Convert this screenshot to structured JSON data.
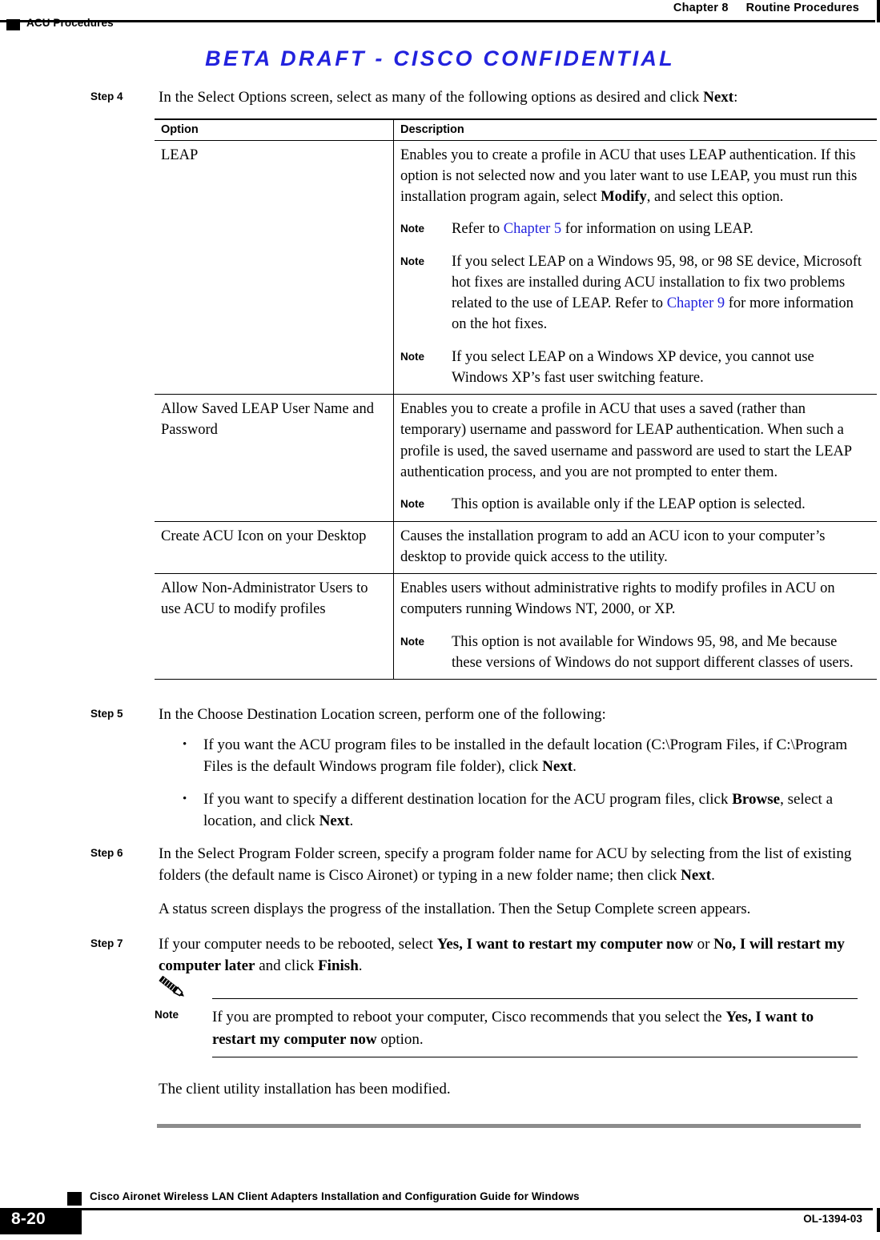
{
  "header": {
    "chapter_number": "Chapter 8",
    "chapter_title": "Routine Procedures",
    "section_label": "ACU Procedures"
  },
  "draft_banner": "BETA DRAFT - CISCO CONFIDENTIAL",
  "steps": {
    "step4": {
      "label": "Step 4",
      "text_a": "In the Select Options screen, select as many of the following options as desired and click ",
      "bold_a": "Next",
      "text_b": ":"
    },
    "step5": {
      "label": "Step 5",
      "text": "In the Choose Destination Location screen, perform one of the following:",
      "bullets": [
        {
          "marker": "•",
          "part1": "If you want the ACU program files to be installed in the default location (C:\\Program Files, if C:\\Program Files is the default Windows program file folder), click ",
          "bold1": "Next",
          "part2": "."
        },
        {
          "marker": "•",
          "part1": "If you want to specify a different destination location for the ACU program files, click ",
          "bold1": "Browse",
          "part2": ", select a location, and click ",
          "bold2": "Next",
          "part3": "."
        }
      ]
    },
    "step6": {
      "label": "Step 6",
      "part1": "In the Select Program Folder screen, specify a program folder name for ACU by selecting from the list of existing folders (the default name is Cisco Aironet) or typing in a new folder name; then click ",
      "bold1": "Next",
      "part2": ".",
      "followup": "A status screen displays the progress of the installation. Then the Setup Complete screen appears."
    },
    "step7": {
      "label": "Step 7",
      "part1": "If your computer needs to be rebooted, select ",
      "bold1": "Yes, I want to restart my computer now",
      "part2": " or ",
      "bold2": "No, I will restart my computer later",
      "part3": " and click ",
      "bold3": "Finish",
      "part4": "."
    }
  },
  "table": {
    "headers": {
      "option": "Option",
      "description": "Description"
    },
    "rows": [
      {
        "option": "LEAP",
        "desc_part1": "Enables you to create a profile in ACU that uses LEAP authentication. If this option is not selected now and you later want to use LEAP, you must run this installation program again, select ",
        "desc_bold1": "Modify",
        "desc_part2": ", and select this option.",
        "notes": [
          {
            "label": "Note",
            "part1": "Refer to ",
            "link1": "Chapter 5",
            "part2": " for information on using LEAP."
          },
          {
            "label": "Note",
            "part1": "If you select LEAP on a Windows 95, 98, or 98 SE device, Microsoft hot fixes are installed during ACU installation to fix two problems related to the use of LEAP. Refer to ",
            "link1": "Chapter 9",
            "part2": " for more information on the hot fixes."
          },
          {
            "label": "Note",
            "part1": "If you select LEAP on a Windows XP device, you cannot use Windows XP’s fast user switching feature.",
            "link1": "",
            "part2": ""
          }
        ]
      },
      {
        "option": "Allow Saved LEAP User Name and Password",
        "desc_part1": "Enables you to create a profile in ACU that uses a saved (rather than temporary) username and password for LEAP authentication. When such a profile is used, the saved username and password are used to start the LEAP authentication process, and you are not prompted to enter them.",
        "desc_bold1": "",
        "desc_part2": "",
        "notes": [
          {
            "label": "Note",
            "part1": "This option is available only if the LEAP option is selected.",
            "link1": "",
            "part2": ""
          }
        ]
      },
      {
        "option": "Create ACU Icon on your Desktop",
        "desc_part1": "Causes the installation program to add an ACU icon to your computer’s desktop to provide quick access to the utility.",
        "desc_bold1": "",
        "desc_part2": "",
        "notes": []
      },
      {
        "option": "Allow Non-Administrator Users to use ACU to modify profiles",
        "desc_part1": "Enables users without administrative rights to modify profiles in ACU on computers running Windows NT, 2000, or XP.",
        "desc_bold1": "",
        "desc_part2": "",
        "notes": [
          {
            "label": "Note",
            "part1": "This option is not available for Windows 95, 98, and Me because these versions of Windows do not support different classes of users.",
            "link1": "",
            "part2": ""
          }
        ]
      }
    ]
  },
  "note_block": {
    "icon_name": "pencil-note-icon",
    "label": "Note",
    "part1": "If you are prompted to reboot your computer, Cisco recommends that you select the ",
    "bold1": "Yes, I want to restart my computer now",
    "part2": " option."
  },
  "closing_text": "The client utility installation has been modified.",
  "footer": {
    "title": "Cisco Aironet Wireless LAN Client Adapters Installation and Configuration Guide for Windows",
    "page_number": "8-20",
    "document_id": "OL-1394-03"
  },
  "colors": {
    "link": "#2222DD",
    "banner": "#2222DD",
    "rule_gray": "#8c8c8c"
  }
}
